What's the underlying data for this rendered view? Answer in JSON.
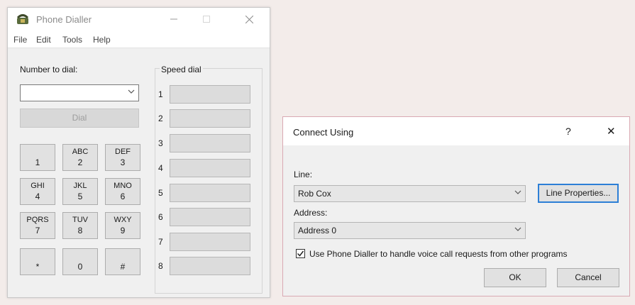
{
  "phone_dialer": {
    "title": "Phone Dialler",
    "menu": [
      "File",
      "Edit",
      "Tools",
      "Help"
    ],
    "number_label": "Number to dial:",
    "number_value": "",
    "dial_label": "Dial",
    "keypad": [
      {
        "letters": "",
        "digit": "1"
      },
      {
        "letters": "ABC",
        "digit": "2"
      },
      {
        "letters": "DEF",
        "digit": "3"
      },
      {
        "letters": "GHI",
        "digit": "4"
      },
      {
        "letters": "JKL",
        "digit": "5"
      },
      {
        "letters": "MNO",
        "digit": "6"
      },
      {
        "letters": "PQRS",
        "digit": "7"
      },
      {
        "letters": "TUV",
        "digit": "8"
      },
      {
        "letters": "WXY",
        "digit": "9"
      },
      {
        "letters": "",
        "digit": "*"
      },
      {
        "letters": "",
        "digit": "0"
      },
      {
        "letters": "",
        "digit": "#"
      }
    ],
    "speed_dial_label": "Speed dial",
    "speed_dial_numbers": [
      "1",
      "2",
      "3",
      "4",
      "5",
      "6",
      "7",
      "8"
    ]
  },
  "connect_using": {
    "title": "Connect Using",
    "help_glyph": "?",
    "close_glyph": "✕",
    "line_label": "Line:",
    "line_value": "Rob Cox",
    "line_properties_label": "Line Properties...",
    "address_label": "Address:",
    "address_value": "Address 0",
    "checkbox_checked": true,
    "checkbox_label": "Use Phone Dialler to handle voice call requests from other programs",
    "ok_label": "OK",
    "cancel_label": "Cancel"
  },
  "icons": {
    "app": "phone-dialer-app-icon",
    "minimize": "minimize-icon",
    "maximize": "maximize-icon",
    "close": "close-icon",
    "dropdown": "chevron-down-icon"
  },
  "colors": {
    "window_bg": "#f0f0f0",
    "titlebar_bg": "#ffffff",
    "button_bg": "#e1e1e1",
    "dialog_border": "#d9a9b3",
    "default_button_border": "#2d7fd6"
  }
}
